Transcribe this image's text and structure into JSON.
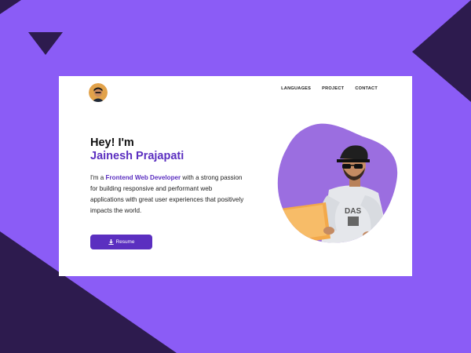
{
  "colors": {
    "background": "#8b5cf6",
    "accent": "#5b2fc0",
    "dark_shape": "#2d1b4e",
    "card": "#ffffff",
    "blob": "#9b6ee0"
  },
  "header": {
    "logo_icon": "avatar-photo",
    "nav": [
      {
        "label": "LANGUAGES"
      },
      {
        "label": "PROJECT"
      },
      {
        "label": "CONTACT"
      }
    ]
  },
  "hero": {
    "greeting": "Hey! I'm",
    "name": "Jainesh Prajapati",
    "description_prefix": "I'm a ",
    "description_highlight": "Frontend Web Developer",
    "description_suffix": " with a strong passion for building responsive and performant web applications with great user experiences that positively impacts the world.",
    "resume_button": {
      "icon": "download-icon",
      "label": "Resume"
    },
    "portrait_icon": "developer-photo"
  }
}
